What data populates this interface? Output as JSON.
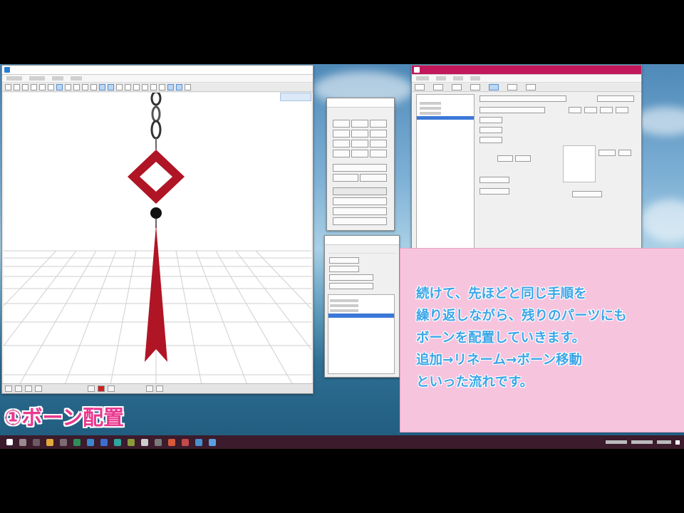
{
  "overlay": {
    "caption": "①ボーン配置",
    "instruction_lines": [
      "続けて、先ほどと同じ手順を",
      "繰り返しながら、残りのパーツにも",
      "ボーンを配置していきます。",
      "追加→リネーム→ボーン移動",
      "といった流れです。"
    ]
  },
  "colors": {
    "caption": "#e8388f",
    "instruction_text": "#3aa6e8",
    "instruction_bg": "#f7c4de",
    "model_red": "#b01525",
    "taskbar": "#3b1b2c",
    "editor_titlebar": "#c2185b"
  },
  "icons": {
    "viewport_app": "pmx-app-icon",
    "taskbar": [
      "start-icon",
      "search-icon",
      "taskview-icon",
      "explorer-icon",
      "browser-icon",
      "app-icon",
      "app-icon",
      "app-icon",
      "app-icon",
      "app-icon",
      "app-icon",
      "app-icon",
      "app-icon",
      "app-icon",
      "app-icon",
      "app-icon",
      "app-icon",
      "app-icon",
      "app-icon",
      "app-icon",
      "app-icon"
    ]
  }
}
